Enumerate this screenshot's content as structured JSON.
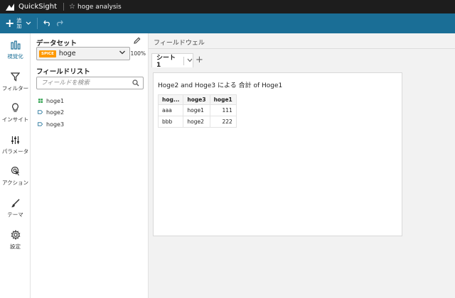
{
  "topbar": {
    "app_name": "QuickSight",
    "analysis_name": "hoge analysis"
  },
  "toolbar": {
    "add_label": "追加"
  },
  "rail": {
    "items": [
      {
        "label": "視覚化",
        "icon": "bar-chart-icon"
      },
      {
        "label": "フィルター",
        "icon": "filter-icon"
      },
      {
        "label": "インサイト",
        "icon": "lightbulb-icon"
      },
      {
        "label": "パラメータ",
        "icon": "sliders-icon"
      },
      {
        "label": "アクション",
        "icon": "pointer-icon"
      },
      {
        "label": "テーマ",
        "icon": "brush-icon"
      },
      {
        "label": "設定",
        "icon": "gear-icon"
      }
    ]
  },
  "datapanel": {
    "dataset_title": "データセット",
    "dataset_badge": "SPICE",
    "dataset_name": "hoge",
    "dataset_percent": "100%",
    "fieldlist_title": "フィールドリスト",
    "search_placeholder": "フィールドを検索",
    "fields": [
      {
        "name": "hoge1",
        "type": "measure"
      },
      {
        "name": "hoge2",
        "type": "dimension"
      },
      {
        "name": "hoge3",
        "type": "dimension"
      }
    ]
  },
  "main": {
    "fieldwell_label": "フィールドウェル",
    "tab_label": "シート 1",
    "visual": {
      "title": "Hoge2 and Hoge3 による 合計 of Hoge1",
      "headers": [
        "hog...",
        "hoge3",
        "hoge1"
      ],
      "rows": [
        [
          "aaa",
          "hoge1",
          "111"
        ],
        [
          "bbb",
          "hoge2",
          "222"
        ]
      ]
    }
  },
  "colors": {
    "toolbar_blue": "#1a6e96",
    "titlebar": "#1d1d1d",
    "spice_orange": "#ff9900",
    "measure_green": "#3aa757",
    "dimension_blue": "#1a6e96"
  }
}
